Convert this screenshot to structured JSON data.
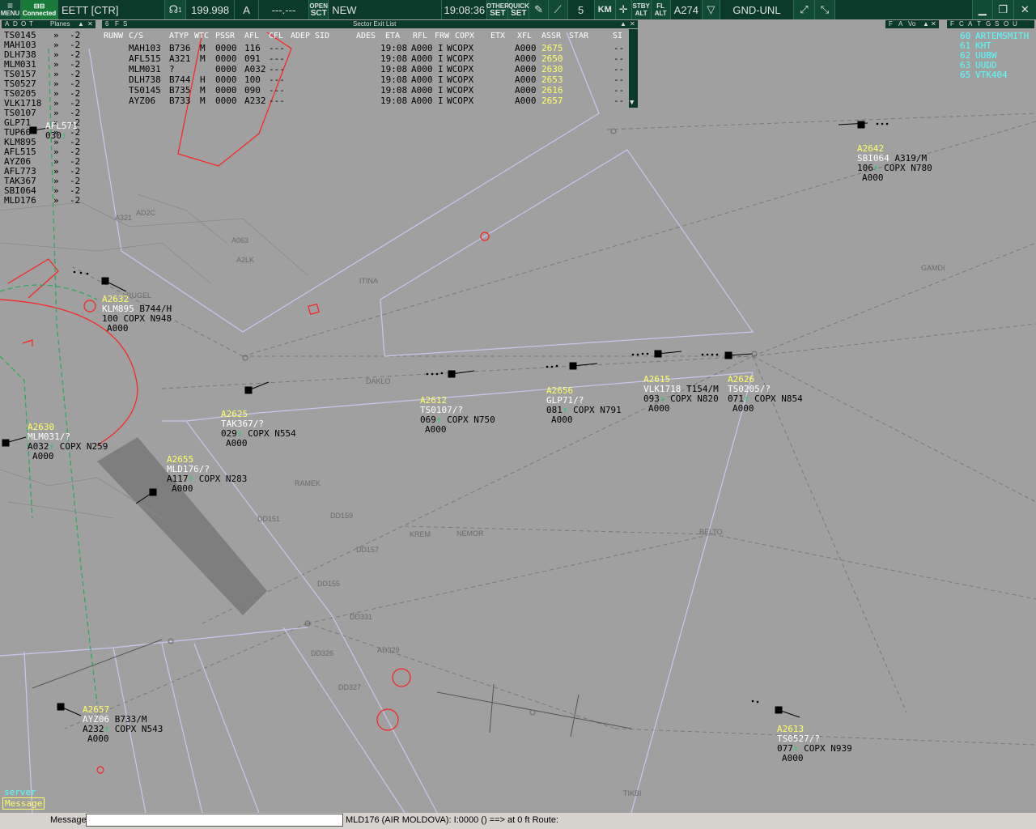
{
  "toolbar": {
    "menu": "MENU",
    "connection": "Connected",
    "callsign": "EETT [CTR]",
    "atis": "1",
    "frequency": "199.998",
    "atis_letter": "A",
    "freq2": "---.---",
    "open_sct_top": "OPEN",
    "open_sct_bottom": "SCT",
    "sector_state": "NEW",
    "time": "19:08:36",
    "other_set_top": "OTHER",
    "other_set_bottom": "SET",
    "quick_set_top": "QUICK",
    "quick_set_bottom": "SET",
    "range": "5",
    "units": "KM",
    "stby_top": "STBY",
    "stby_bottom": "ALT",
    "fl_top": "FL",
    "fl_bottom": "ALT",
    "altitude": "A274",
    "filter": "GND-UNL"
  },
  "planes_panel": {
    "tabs": [
      "A",
      "D",
      "O",
      "T"
    ],
    "title": "Planes",
    "rows": [
      {
        "cs": "TS0145",
        "d": "»",
        "v": "-2"
      },
      {
        "cs": "MAH103",
        "d": "»",
        "v": "-2"
      },
      {
        "cs": "DLH738",
        "d": "»",
        "v": "-2"
      },
      {
        "cs": "MLM031",
        "d": "»",
        "v": "-2"
      },
      {
        "cs": "TS0157",
        "d": "»",
        "v": "-2"
      },
      {
        "cs": "TS0527",
        "d": "»",
        "v": "-2"
      },
      {
        "cs": "TS0205",
        "d": "»",
        "v": "-2"
      },
      {
        "cs": "VLK1718",
        "d": "»",
        "v": "-2"
      },
      {
        "cs": "TS0107",
        "d": "»",
        "v": "-2"
      },
      {
        "cs": "GLP71",
        "d": "»",
        "v": "-2"
      },
      {
        "cs": "TUP60",
        "d": "»",
        "v": "-2"
      },
      {
        "cs": "KLM895",
        "d": "»",
        "v": "-2"
      },
      {
        "cs": "AFL515",
        "d": "»",
        "v": "-2"
      },
      {
        "cs": "AYZ06",
        "d": "»",
        "v": "-2"
      },
      {
        "cs": "AFL773",
        "d": "»",
        "v": "-2"
      },
      {
        "cs": "TAK367",
        "d": "»",
        "v": "-2"
      },
      {
        "cs": "SBI064",
        "d": "»",
        "v": "-2"
      },
      {
        "cs": "MLD176",
        "d": "»",
        "v": "-2"
      }
    ]
  },
  "exit_list": {
    "tabs": [
      "6",
      "F",
      "S"
    ],
    "title": "Sector Exit List",
    "headers": [
      "RUNW",
      "C/S",
      "ATYP",
      "WTC",
      "PSSR",
      "AFL",
      "CFL",
      "ADEP",
      "SID",
      "ADES",
      "ETA",
      "RFL",
      "FRW",
      "COPX",
      "ETX",
      "XFL",
      "ASSR",
      "STAR",
      "SI"
    ],
    "rows": [
      {
        "cs": "MAH103",
        "atyp": "B736",
        "wtc": "M",
        "pssr": "0000",
        "afl": "116",
        "cfl": "---",
        "eta": "19:08",
        "rfl": "A000",
        "frw": "I",
        "copx": "WCOPX",
        "xfl": "A000",
        "assr": "2675",
        "si": "--"
      },
      {
        "cs": "AFL515",
        "atyp": "A321",
        "wtc": "M",
        "pssr": "0000",
        "afl": "091",
        "cfl": "---",
        "eta": "19:08",
        "rfl": "A000",
        "frw": "I",
        "copx": "WCOPX",
        "xfl": "A000",
        "assr": "2650",
        "si": "--"
      },
      {
        "cs": "MLM031",
        "atyp": "?",
        "wtc": "",
        "pssr": "0000",
        "afl": "A032",
        "cfl": "---",
        "eta": "19:08",
        "rfl": "A000",
        "frw": "I",
        "copx": "WCOPX",
        "xfl": "A000",
        "assr": "2630",
        "si": "--"
      },
      {
        "cs": "DLH738",
        "atyp": "B744",
        "wtc": "H",
        "pssr": "0000",
        "afl": "100",
        "cfl": "---",
        "eta": "19:08",
        "rfl": "A000",
        "frw": "I",
        "copx": "WCOPX",
        "xfl": "A000",
        "assr": "2653",
        "si": "--"
      },
      {
        "cs": "TS0145",
        "atyp": "B735",
        "wtc": "M",
        "pssr": "0000",
        "afl": "090",
        "cfl": "---",
        "eta": "19:08",
        "rfl": "A000",
        "frw": "I",
        "copx": "WCOPX",
        "xfl": "A000",
        "assr": "2616",
        "si": "--"
      },
      {
        "cs": "AYZ06",
        "atyp": "B733",
        "wtc": "M",
        "pssr": "0000",
        "afl": "A232",
        "cfl": "---",
        "eta": "19:08",
        "rfl": "A000",
        "frw": "I",
        "copx": "WCOPX",
        "xfl": "A000",
        "assr": "2657",
        "si": "--"
      }
    ]
  },
  "facilities_panel": {
    "tabs": [
      "F",
      "A",
      "Vo"
    ]
  },
  "right_panel": {
    "tabs": [
      "F",
      "C",
      "A",
      "T",
      "G",
      "S",
      "O",
      "U"
    ],
    "rows": [
      {
        "num": "60",
        "name": "ARTEMSMITH"
      },
      {
        "num": "61",
        "name": "KHT"
      },
      {
        "num": "62",
        "name": "UUBW"
      },
      {
        "num": "63",
        "name": "UUDD"
      },
      {
        "num": "65",
        "name": "VTK404"
      }
    ]
  },
  "targets": [
    {
      "ssr": "A2642",
      "cs": "SBI064",
      "type": "A319/M",
      "alt": "106",
      "arrow": "↑",
      "copx": "COPX",
      "route": "N780",
      "xfl": "A000"
    },
    {
      "ssr": "A2632",
      "cs": "KLM895",
      "type": "B744/H",
      "alt": "100",
      "arrow": "",
      "copx": "COPX",
      "route": "N948",
      "xfl": "A000"
    },
    {
      "ssr": "A2612",
      "cs": "TS0107/?",
      "type": "",
      "alt": "069",
      "arrow": "↑",
      "copx": "COPX",
      "route": "N750",
      "xfl": "A000"
    },
    {
      "ssr": "A2656",
      "cs": "GLP71/?",
      "type": "",
      "alt": "081",
      "arrow": "↑",
      "copx": "COPX",
      "route": "N791",
      "xfl": "A000"
    },
    {
      "ssr": "A2615",
      "cs": "VLK1718",
      "type": "T154/M",
      "alt": "093",
      "arrow": "↑",
      "copx": "COPX",
      "route": "N820",
      "xfl": "A000"
    },
    {
      "ssr": "A2626",
      "cs": "TS0205/?",
      "type": "",
      "alt": "071",
      "arrow": "↑",
      "copx": "COPX",
      "route": "N854",
      "xfl": "A000"
    },
    {
      "ssr": "A2625",
      "cs": "TAK367/?",
      "type": "",
      "alt": "029",
      "arrow": "↑",
      "copx": "COPX",
      "route": "N554",
      "xfl": "A000"
    },
    {
      "ssr": "A2630",
      "cs": "MLM031/?",
      "type": "",
      "alt": "A032",
      "arrow": "↑",
      "copx": "COPX",
      "route": "N259",
      "xfl": "A000"
    },
    {
      "ssr": "A2655",
      "cs": "MLD176/?",
      "type": "",
      "alt": "A117",
      "arrow": "↑",
      "copx": "COPX",
      "route": "N283",
      "xfl": "A000"
    },
    {
      "ssr": "A2657",
      "cs": "AYZ06",
      "type": "B733/M",
      "alt": "A232",
      "arrow": "↑",
      "copx": "COPX",
      "route": "N543",
      "xfl": "A000"
    },
    {
      "ssr": "A2613",
      "cs": "TS0527/?",
      "type": "",
      "alt": "077",
      "arrow": "↑",
      "copx": "COPX",
      "route": "N939",
      "xfl": "A000"
    },
    {
      "ssr": "",
      "cs": "AFL571",
      "type": "",
      "alt": "030",
      "arrow": "↑",
      "copx": "",
      "route": "",
      "xfl": ""
    }
  ],
  "fixes": [
    "GAMDI",
    "ITINA",
    "RUGEL",
    "DAKLO",
    "BELTO",
    "KREM",
    "NEMOR",
    "TIKBI",
    "AD329",
    "DD326",
    "DD327",
    "DD331",
    "DD155",
    "DD157",
    "DD159",
    "DD151",
    "A063",
    "A2LK",
    "A321",
    "AD2C",
    "RAMEK"
  ],
  "side_buttons": {
    "server": "server",
    "message": "Message"
  },
  "status_bar": {
    "message_label": "Message",
    "info": "MLD176 (AIR MOLDOVA):  I:0000 () ==> at 0 ft Route:"
  },
  "colors": {
    "toolbar_bg": "#0b3a2a",
    "scope_bg": "#a0a0a0",
    "sector_line": "#c8c8f0",
    "restricted": "#ff2020",
    "ssr_code": "#ffff66",
    "callsign": "#ffffff"
  }
}
